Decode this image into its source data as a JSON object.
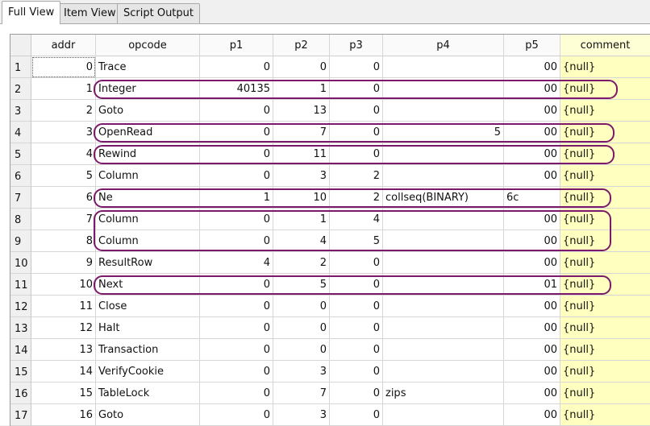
{
  "tabs": [
    {
      "label": "Full View",
      "active": true
    },
    {
      "label": "Item View",
      "active": false
    },
    {
      "label": "Script Output",
      "active": false
    }
  ],
  "columns": [
    "addr",
    "opcode",
    "p1",
    "p2",
    "p3",
    "p4",
    "p5",
    "comment"
  ],
  "rows": [
    {
      "n": "1",
      "addr": "0",
      "opcode": "Trace",
      "p1": "0",
      "p2": "0",
      "p3": "0",
      "p4": "",
      "p5": "00",
      "comment": "{null}"
    },
    {
      "n": "2",
      "addr": "1",
      "opcode": "Integer",
      "p1": "40135",
      "p2": "1",
      "p3": "0",
      "p4": "",
      "p5": "00",
      "comment": "{null}"
    },
    {
      "n": "3",
      "addr": "2",
      "opcode": "Goto",
      "p1": "0",
      "p2": "13",
      "p3": "0",
      "p4": "",
      "p5": "00",
      "comment": "{null}"
    },
    {
      "n": "4",
      "addr": "3",
      "opcode": "OpenRead",
      "p1": "0",
      "p2": "7",
      "p3": "0",
      "p4": "5",
      "p5": "00",
      "comment": "{null}"
    },
    {
      "n": "5",
      "addr": "4",
      "opcode": "Rewind",
      "p1": "0",
      "p2": "11",
      "p3": "0",
      "p4": "",
      "p5": "00",
      "comment": "{null}"
    },
    {
      "n": "6",
      "addr": "5",
      "opcode": "Column",
      "p1": "0",
      "p2": "3",
      "p3": "2",
      "p4": "",
      "p5": "00",
      "comment": "{null}"
    },
    {
      "n": "7",
      "addr": "6",
      "opcode": "Ne",
      "p1": "1",
      "p2": "10",
      "p3": "2",
      "p4": "collseq(BINARY)",
      "p5": "6c",
      "comment": "{null}"
    },
    {
      "n": "8",
      "addr": "7",
      "opcode": "Column",
      "p1": "0",
      "p2": "1",
      "p3": "4",
      "p4": "",
      "p5": "00",
      "comment": "{null}"
    },
    {
      "n": "9",
      "addr": "8",
      "opcode": "Column",
      "p1": "0",
      "p2": "4",
      "p3": "5",
      "p4": "",
      "p5": "00",
      "comment": "{null}"
    },
    {
      "n": "10",
      "addr": "9",
      "opcode": "ResultRow",
      "p1": "4",
      "p2": "2",
      "p3": "0",
      "p4": "",
      "p5": "00",
      "comment": "{null}"
    },
    {
      "n": "11",
      "addr": "10",
      "opcode": "Next",
      "p1": "0",
      "p2": "5",
      "p3": "0",
      "p4": "",
      "p5": "01",
      "comment": "{null}"
    },
    {
      "n": "12",
      "addr": "11",
      "opcode": "Close",
      "p1": "0",
      "p2": "0",
      "p3": "0",
      "p4": "",
      "p5": "00",
      "comment": "{null}"
    },
    {
      "n": "13",
      "addr": "12",
      "opcode": "Halt",
      "p1": "0",
      "p2": "0",
      "p3": "0",
      "p4": "",
      "p5": "00",
      "comment": "{null}"
    },
    {
      "n": "14",
      "addr": "13",
      "opcode": "Transaction",
      "p1": "0",
      "p2": "0",
      "p3": "0",
      "p4": "",
      "p5": "00",
      "comment": "{null}"
    },
    {
      "n": "15",
      "addr": "14",
      "opcode": "VerifyCookie",
      "p1": "0",
      "p2": "3",
      "p3": "0",
      "p4": "",
      "p5": "00",
      "comment": "{null}"
    },
    {
      "n": "16",
      "addr": "15",
      "opcode": "TableLock",
      "p1": "0",
      "p2": "7",
      "p3": "0",
      "p4": "zips",
      "p5": "00",
      "comment": "{null}"
    },
    {
      "n": "17",
      "addr": "16",
      "opcode": "Goto",
      "p1": "0",
      "p2": "3",
      "p3": "0",
      "p4": "",
      "p5": "00",
      "comment": "{null}"
    }
  ],
  "highlight_color": "#7b1a6b",
  "comment_bg": "#ffffc0"
}
